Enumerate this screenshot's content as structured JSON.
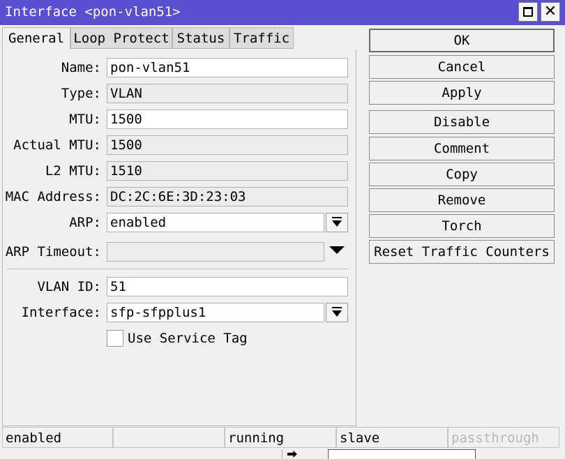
{
  "window": {
    "title": "Interface <pon-vlan51>"
  },
  "tabs": [
    "General",
    "Loop Protect",
    "Status",
    "Traffic"
  ],
  "form": {
    "name": {
      "label": "Name:",
      "value": "pon-vlan51"
    },
    "type": {
      "label": "Type:",
      "value": "VLAN"
    },
    "mtu": {
      "label": "MTU:",
      "value": "1500"
    },
    "actual_mtu": {
      "label": "Actual MTU:",
      "value": "1500"
    },
    "l2_mtu": {
      "label": "L2 MTU:",
      "value": "1510"
    },
    "mac": {
      "label": "MAC Address:",
      "value": "DC:2C:6E:3D:23:03"
    },
    "arp": {
      "label": "ARP:",
      "value": "enabled"
    },
    "arp_timeout": {
      "label": "ARP Timeout:",
      "value": ""
    },
    "vlan_id": {
      "label": "VLAN ID:",
      "value": "51"
    },
    "interface": {
      "label": "Interface:",
      "value": "sfp-sfpplus1"
    },
    "service_tag": {
      "label": "Use Service Tag",
      "checked": false
    }
  },
  "buttons": {
    "ok": "OK",
    "cancel": "Cancel",
    "apply": "Apply",
    "disable": "Disable",
    "comment": "Comment",
    "copy": "Copy",
    "remove": "Remove",
    "torch": "Torch",
    "reset": "Reset Traffic Counters"
  },
  "status_bar": [
    "enabled",
    "",
    "running",
    "slave",
    "passthrough"
  ],
  "icons": {
    "maximize": "maximize-icon",
    "close": "close-icon",
    "dropdown": "dropdown-arrow-icon"
  },
  "colors": {
    "titlebar": "#5a4fd0",
    "disabled_text": "#b8b8b8"
  }
}
